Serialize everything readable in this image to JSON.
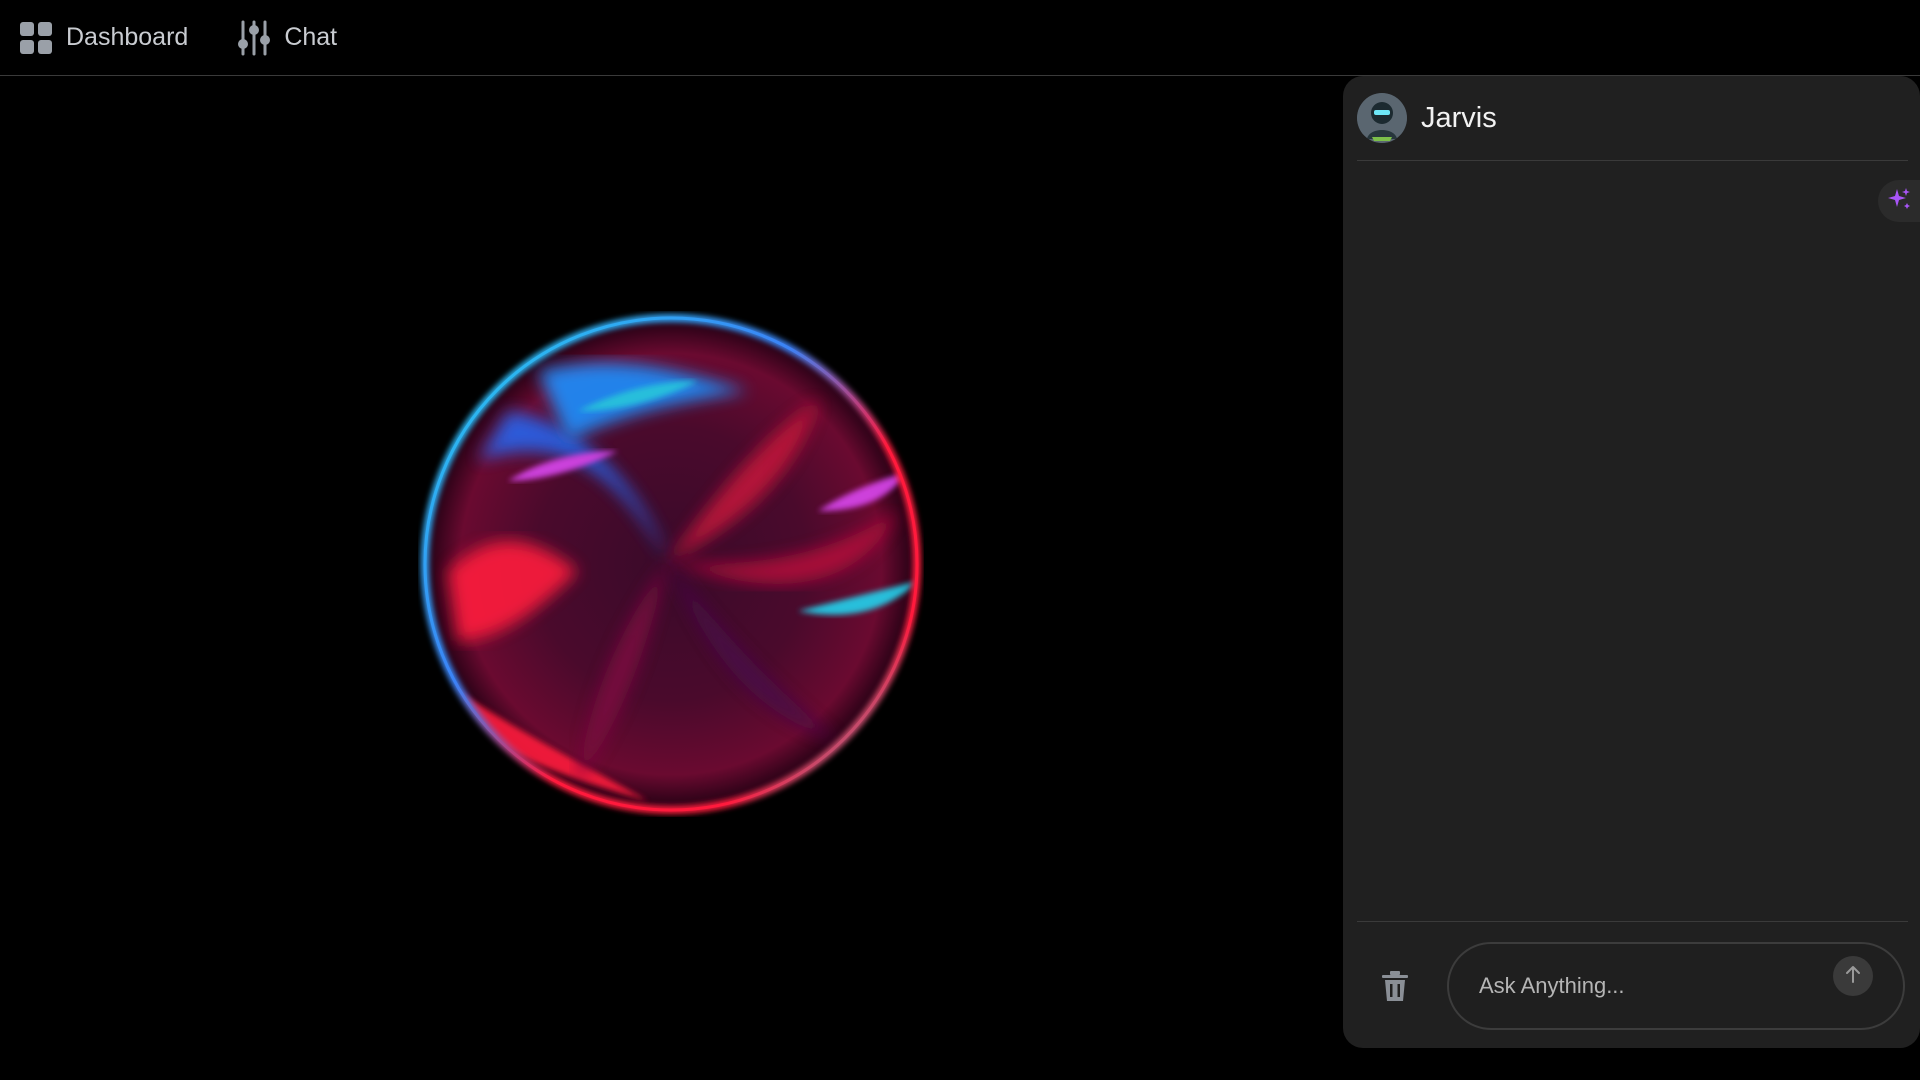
{
  "nav": {
    "items": [
      {
        "label": "Dashboard",
        "icon": "grid-icon"
      },
      {
        "label": "Chat",
        "icon": "sliders-icon"
      }
    ]
  },
  "chat": {
    "agent_name": "Jarvis",
    "avatar_icon": "robot-avatar",
    "input_placeholder": "Ask Anything...",
    "input_value": ""
  },
  "colors": {
    "background": "#000000",
    "panel": "#202020",
    "orb_cyan": "#22d3ee",
    "orb_blue": "#2563eb",
    "orb_red": "#ff1a3c",
    "orb_magenta": "#d946ef",
    "accent_spark": "#a855f7"
  }
}
